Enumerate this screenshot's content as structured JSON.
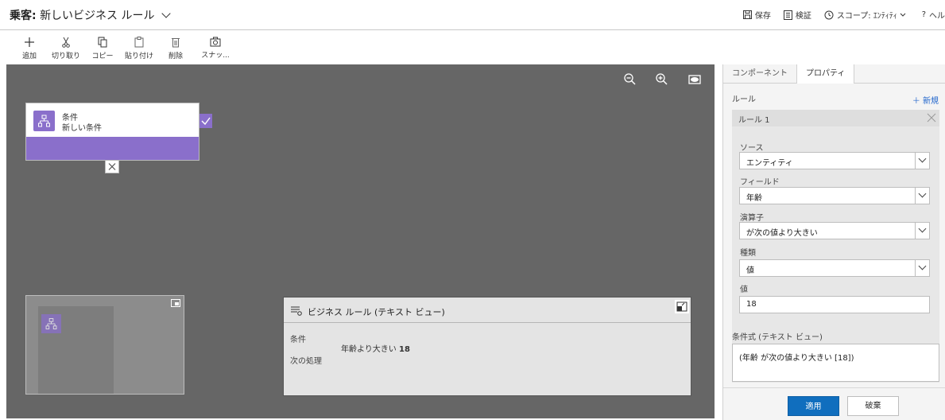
{
  "header": {
    "entity_label": "乗客:",
    "rule_title": "新しいビジネス ルール",
    "actions": {
      "save": "保存",
      "validate": "検証",
      "scope_label": "スコープ:",
      "scope_value": "ｴﾝﾃｨﾃｨ",
      "help": "ヘル"
    }
  },
  "toolbar": {
    "add": "追加",
    "cut": "切り取り",
    "copy": "コピー",
    "paste": "貼り付け",
    "delete": "削除",
    "snapshot": "スナッ..."
  },
  "canvas": {
    "condition_node": {
      "type_label": "条件",
      "name": "新しい条件"
    },
    "text_view": {
      "title": "ビジネス ルール (テキスト ビュー)",
      "condition_label": "条件",
      "action_label": "次の処理",
      "condition_text": "年齢より大きい",
      "condition_value": "18"
    }
  },
  "panel": {
    "tabs": [
      "コンポーネント",
      "プロパティ"
    ],
    "active_tab": "プロパティ",
    "rules_label": "ルール",
    "new_link": "＋ 新規",
    "rule_name": "ルール 1",
    "source_label": "ソース",
    "source_value": "エンティティ",
    "field_label": "フィールド",
    "field_value": "年齢",
    "operator_label": "演算子",
    "operator_value": "が次の値より大きい",
    "type_label": "種類",
    "type_value": "値",
    "value_label": "値",
    "value_value": "18",
    "expression_label": "条件式 (テキスト ビュー)",
    "expression_value": "(年齢 が次の値より大きい [18])",
    "apply_button": "適用",
    "discard_button": "破棄"
  },
  "colors": {
    "canvas_bg": "#666666",
    "condition_accent": "#8a6fcb",
    "primary_button": "#106ebe",
    "link": "#2266cc"
  }
}
